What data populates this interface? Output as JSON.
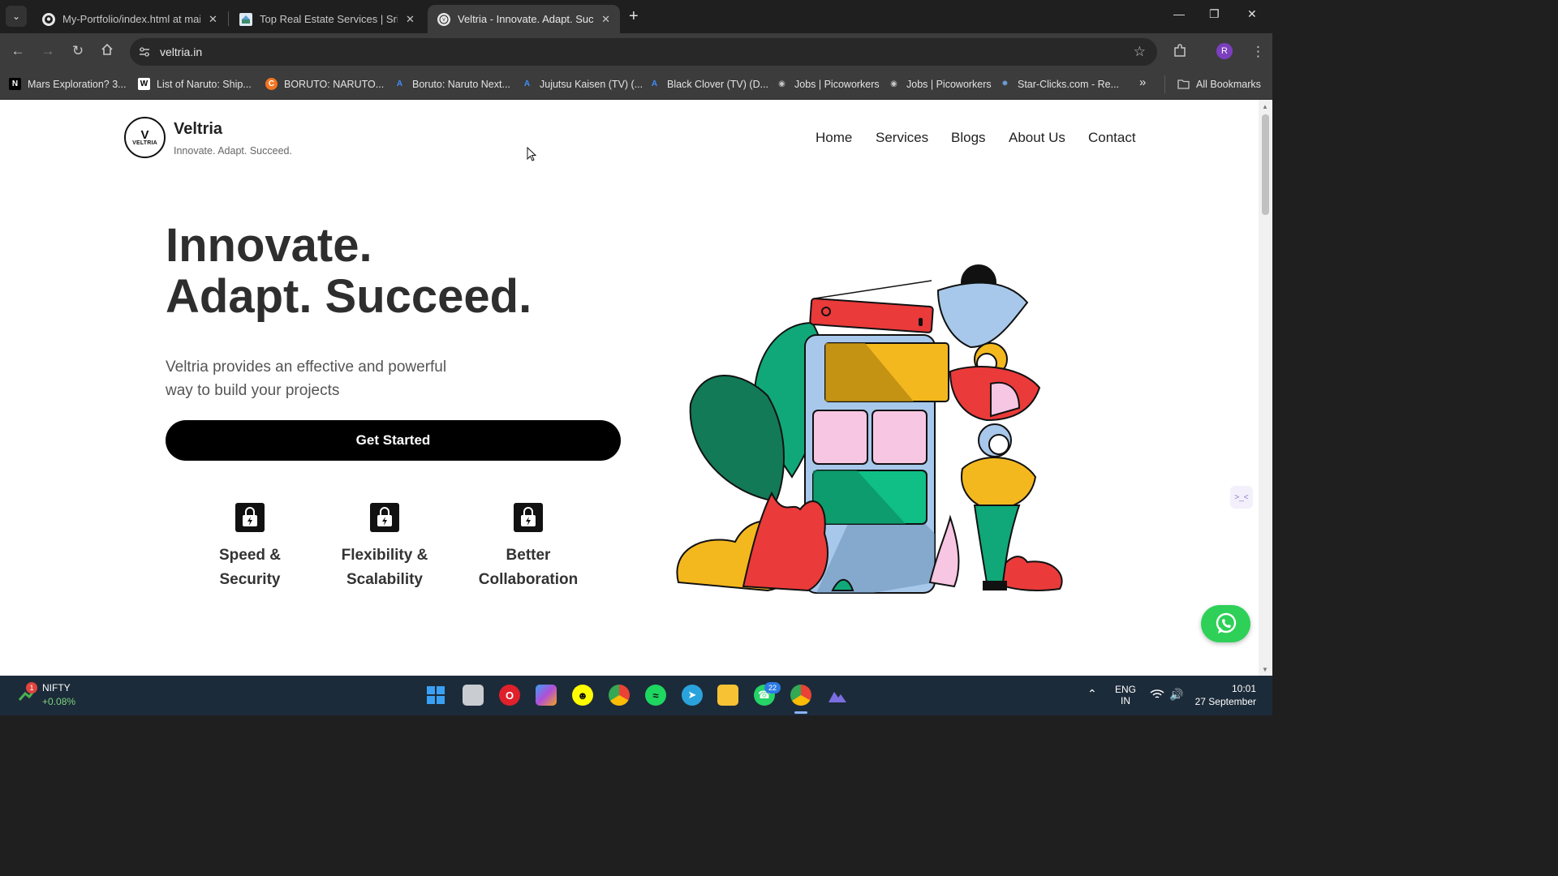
{
  "browser": {
    "tabs": [
      {
        "title": "My-Portfolio/index.html at main",
        "active": false
      },
      {
        "title": "Top Real Estate Services | Srini P",
        "active": false
      },
      {
        "title": "Veltria - Innovate. Adapt. Succeed",
        "active": true
      }
    ],
    "url": "veltria.in",
    "profile_initial": "R",
    "bookmarks": [
      "Mars Exploration? 3...",
      "List of Naruto: Ship...",
      "BORUTO: NARUTO...",
      "Boruto: Naruto Next...",
      "Jujutsu Kaisen (TV) (...",
      "Black Clover (TV) (D...",
      "Jobs | Picoworkers",
      "Jobs | Picoworkers",
      "Star-Clicks.com - Re..."
    ],
    "bookmarks_more": "»",
    "all_bookmarks": "All Bookmarks"
  },
  "site": {
    "logo_text": "VELTRIA",
    "brand_name": "Veltria",
    "tagline": "Innovate. Adapt. Succeed.",
    "nav": [
      "Home",
      "Services",
      "Blogs",
      "About Us",
      "Contact"
    ],
    "hero": {
      "title_line1": "Innovate.",
      "title_line2": "Adapt. Succeed.",
      "subtitle": "Veltria provides an effective and powerful way to build your projects",
      "cta": "Get Started"
    },
    "features": [
      {
        "line1": "Speed &",
        "line2": "Security"
      },
      {
        "line1": "Flexibility &",
        "line2": "Scalability"
      },
      {
        "line1": "Better",
        "line2": "Collaboration"
      }
    ]
  },
  "taskbar": {
    "widget_name": "NIFTY",
    "widget_value": "+0.08%",
    "widget_badge": "1",
    "whatsapp_badge": "22",
    "lang_line1": "ENG",
    "lang_line2": "IN",
    "time": "10:01",
    "date": "27 September"
  }
}
